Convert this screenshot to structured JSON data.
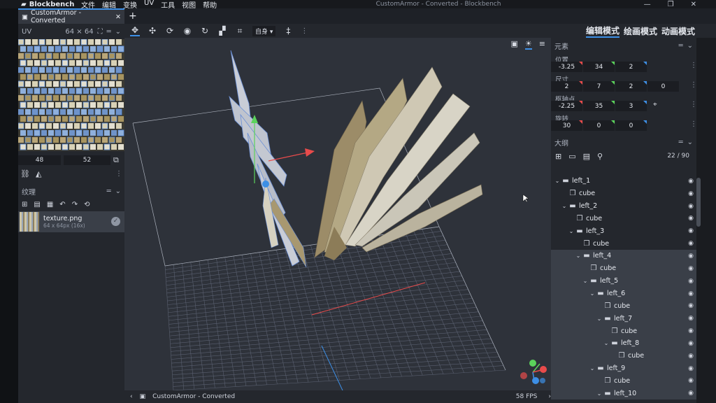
{
  "app": {
    "name": "Blockbench",
    "window_title": "CustomArmor - Converted - Blockbench",
    "menu": [
      "文件",
      "编辑",
      "变换",
      "UV",
      "工具",
      "视图",
      "帮助"
    ],
    "window_controls": [
      "—",
      "❐",
      "✕"
    ]
  },
  "tabs": [
    {
      "label": "CustomArmor - Converted"
    }
  ],
  "uv_panel": {
    "title": "UV",
    "size": "64 × 64",
    "input_a": "48",
    "input_b": "52"
  },
  "texture_panel": {
    "title": "纹理",
    "texture": {
      "name": "texture.png",
      "info": "64 x 64px (16x)"
    }
  },
  "toolbar": {
    "space_select": "自身"
  },
  "modes": {
    "edit": "编辑模式",
    "paint": "绘画模式",
    "animate": "动画模式"
  },
  "element_panel": {
    "title": "元素",
    "position": {
      "label": "位置",
      "values": [
        "-3.25",
        "34",
        "2"
      ]
    },
    "size": {
      "label": "尺寸",
      "values": [
        "2",
        "7",
        "2",
        "0"
      ]
    },
    "pivot": {
      "label": "枢轴点",
      "values": [
        "-2.25",
        "35",
        "3"
      ]
    },
    "rotation": {
      "label": "旋转",
      "values": [
        "30",
        "0",
        "0"
      ]
    }
  },
  "outliner": {
    "title": "大纲",
    "count": "22 / 90",
    "items": [
      {
        "label": "left_1",
        "type": "group",
        "depth": 0,
        "selected": false
      },
      {
        "label": "cube",
        "type": "cube",
        "depth": 1,
        "selected": false
      },
      {
        "label": "left_2",
        "type": "group",
        "depth": 1,
        "selected": false
      },
      {
        "label": "cube",
        "type": "cube",
        "depth": 2,
        "selected": false
      },
      {
        "label": "left_3",
        "type": "group",
        "depth": 2,
        "selected": false
      },
      {
        "label": "cube",
        "type": "cube",
        "depth": 3,
        "selected": false
      },
      {
        "label": "left_4",
        "type": "group",
        "depth": 3,
        "selected": true
      },
      {
        "label": "cube",
        "type": "cube",
        "depth": 4,
        "selected": true
      },
      {
        "label": "left_5",
        "type": "group",
        "depth": 4,
        "selected": true
      },
      {
        "label": "left_6",
        "type": "group",
        "depth": 5,
        "selected": true
      },
      {
        "label": "cube",
        "type": "cube",
        "depth": 6,
        "selected": true
      },
      {
        "label": "left_7",
        "type": "group",
        "depth": 6,
        "selected": true
      },
      {
        "label": "cube",
        "type": "cube",
        "depth": 7,
        "selected": true
      },
      {
        "label": "left_8",
        "type": "group",
        "depth": 7,
        "selected": true
      },
      {
        "label": "cube",
        "type": "cube",
        "depth": 8,
        "selected": true
      },
      {
        "label": "left_9",
        "type": "group",
        "depth": 5,
        "selected": true
      },
      {
        "label": "cube",
        "type": "cube",
        "depth": 6,
        "selected": true
      },
      {
        "label": "left_10",
        "type": "group",
        "depth": 6,
        "selected": true
      }
    ]
  },
  "statusbar": {
    "project": "CustomArmor - Converted",
    "fps": "58 FPS"
  },
  "colors": {
    "accent": "#3d8fe6",
    "panel": "#24272d",
    "viewport": "#2e323a",
    "x_axis": "#e84b4b",
    "y_axis": "#5bd35b",
    "z_axis": "#3d8fe6"
  }
}
